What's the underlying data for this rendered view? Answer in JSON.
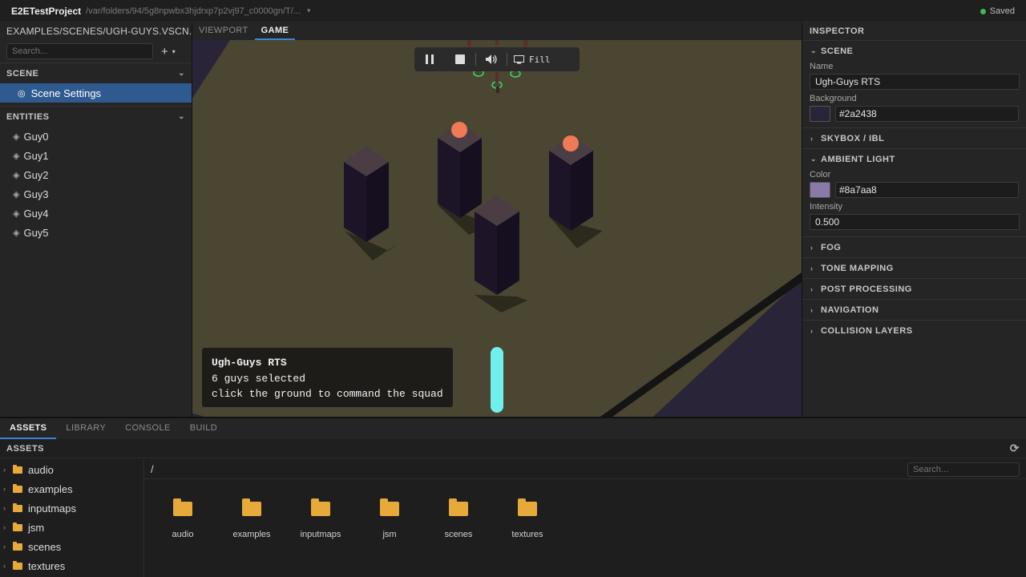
{
  "app": {
    "name": "E2ETestProject",
    "path": "/var/folders/94/5g8npwbx3hjdrxp7p2vj97_c0000gn/T/...",
    "status": "Saved",
    "status_color": "#3fb950"
  },
  "left": {
    "file_path": "EXAMPLES/SCENES/UGH-GUYS.VSCN.JSON",
    "search_placeholder": "Search...",
    "scene_header": "SCENE",
    "scene_item": "Scene Settings",
    "entities_header": "ENTITIES",
    "entities": [
      "Guy0",
      "Guy1",
      "Guy2",
      "Guy3",
      "Guy4",
      "Guy5"
    ]
  },
  "center": {
    "tabs": [
      "VIEWPORT",
      "GAME"
    ],
    "active_tab": "GAME",
    "fill_label": "Fill",
    "hud": {
      "title": "Ugh-Guys RTS",
      "line1": "6 guys selected",
      "line2": "click the ground to command the squad"
    }
  },
  "inspector": {
    "title": "INSPECTOR",
    "scene_section": "SCENE",
    "name_label": "Name",
    "name_value": "Ugh-Guys RTS",
    "background_label": "Background",
    "background_value": "#2a2438",
    "skybox": "SKYBOX / IBL",
    "ambient_section": "AMBIENT LIGHT",
    "color_label": "Color",
    "color_value": "#8a7aa8",
    "intensity_label": "Intensity",
    "intensity_value": "0.500",
    "collapsed_sections": [
      "FOG",
      "TONE MAPPING",
      "POST PROCESSING",
      "NAVIGATION",
      "COLLISION LAYERS"
    ]
  },
  "bottom": {
    "tabs": [
      "ASSETS",
      "LIBRARY",
      "CONSOLE",
      "BUILD"
    ],
    "active_tab": "ASSETS",
    "assets_header": "ASSETS",
    "tree": [
      "audio",
      "examples",
      "inputmaps",
      "jsm",
      "scenes",
      "textures"
    ],
    "crumb": "/",
    "search_placeholder": "Search...",
    "folders": [
      "audio",
      "examples",
      "inputmaps",
      "jsm",
      "scenes",
      "textures"
    ]
  },
  "icons": {
    "pause": "pause-icon",
    "stop": "stop-icon",
    "volume": "volume-icon",
    "monitor": "monitor-icon",
    "globe": "globe-icon",
    "cube": "cube-icon",
    "folder": "folder-icon",
    "refresh": "refresh-icon"
  },
  "colors": {
    "accent": "#3d86d6",
    "selection": "#2f5a8f",
    "folder": "#e6a93a"
  }
}
